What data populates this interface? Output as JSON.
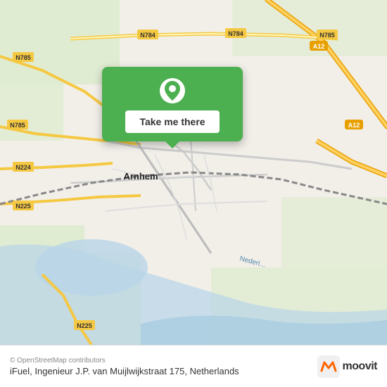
{
  "map": {
    "location": "Arnhem, Netherlands",
    "attribution": "© OpenStreetMap contributors",
    "neder_label": "Nederi..."
  },
  "popup": {
    "button_label": "Take me there"
  },
  "footer": {
    "address": "iFuel, Ingenieur J.P. van Muijlwijkstraat 175,",
    "country": "Netherlands",
    "logo_text": "moovit"
  },
  "road_labels": {
    "arnhem": "Arnhem",
    "n784_1": "N784",
    "n784_2": "N784",
    "n785_1": "N785",
    "n785_2": "N785",
    "n785_3": "N785",
    "n224": "N224",
    "n225_1": "N225",
    "n225_2": "N225",
    "a12_1": "A12",
    "a12_2": "A12",
    "neder": "Nederi..."
  }
}
